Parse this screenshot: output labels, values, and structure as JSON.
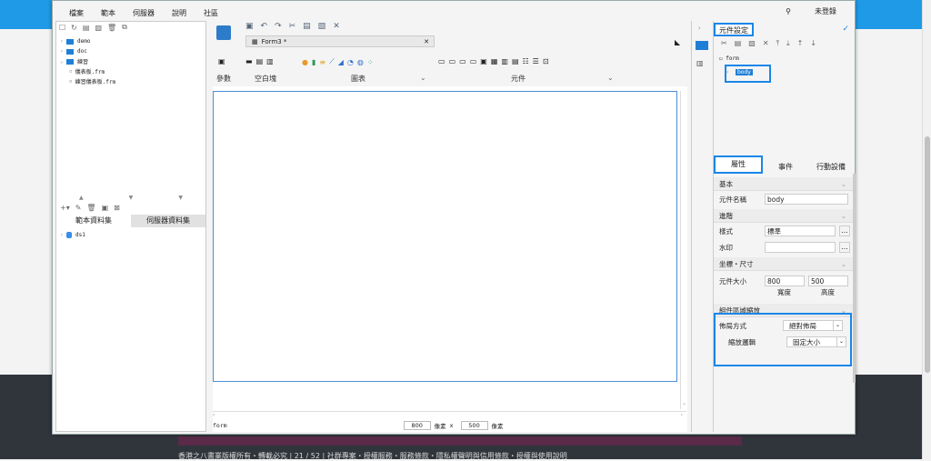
{
  "menu": {
    "items": [
      "檔案",
      "範本",
      "伺服器",
      "說明",
      "社區"
    ],
    "login": "未登錄"
  },
  "left": {
    "tree": [
      {
        "label": "demo",
        "type": "folder"
      },
      {
        "label": "doc",
        "type": "folder"
      },
      {
        "label": "練習",
        "type": "folder"
      },
      {
        "label": "儀表板.frm",
        "type": "file"
      },
      {
        "label": "練習儀表板.frm",
        "type": "file"
      }
    ],
    "tabs": [
      "範本資料集",
      "伺服器資料集"
    ],
    "ds_item": "ds1"
  },
  "center": {
    "tab_title": "Form3 *",
    "groups": {
      "param": "參數",
      "blank": "空白塊",
      "chart": "圖表",
      "widget": "元件"
    },
    "status": {
      "name": "form",
      "width": "800",
      "unit1": "像素",
      "x": "x",
      "height": "500",
      "unit2": "像素"
    }
  },
  "right": {
    "title": "元件設定",
    "tree_root": "form",
    "tree_child": "body",
    "tabs": [
      "屬性",
      "事件",
      "行動設備"
    ],
    "sections": {
      "basic": "基本",
      "advanced": "進階",
      "coord": "坐標・尺寸",
      "scale": "組件區域縮放"
    },
    "fields": {
      "name_label": "元件名稱",
      "name_value": "body",
      "style_label": "樣式",
      "style_value": "標準",
      "watermark_label": "水印",
      "size_label": "元件大小",
      "w_value": "800",
      "h_value": "500",
      "w_caption": "寬度",
      "h_caption": "高度",
      "layout_label": "佈局方式",
      "layout_value": "絕對佈局",
      "scale_label": "縮放邏輯",
      "scale_value": "固定大小"
    }
  },
  "bg_text": "香港之八書業版權所有・轉載必究 | 21 / 52 | 社群專案・授權服務・服務條款・隱私權聲明與信用條款・授權與使用說明"
}
